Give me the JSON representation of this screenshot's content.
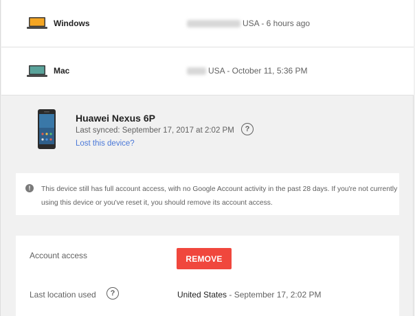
{
  "devices": [
    {
      "name": "Windows",
      "location_suffix": "USA - 6 hours ago",
      "icon": "laptop-icon-yellow"
    },
    {
      "name": "Mac",
      "location_suffix": "USA - October 11, 5:36 PM",
      "icon": "laptop-icon-teal"
    }
  ],
  "phone": {
    "title": "Huawei Nexus 6P",
    "last_synced": "Last synced: September 17, 2017 at 2:02 PM",
    "lost_link": "Lost this device?",
    "help_glyph": "?"
  },
  "notice": {
    "icon_glyph": "!",
    "text": "This device still has full account access, with no Google Account activity in the past 28 days. If you're not currently using this device or you've reset it, you should remove its account access."
  },
  "access": {
    "label": "Account access",
    "remove_label": "REMOVE",
    "location_label": "Last location used",
    "location_value": "United States",
    "location_time": " - September 17, 2:02 PM",
    "help_glyph": "?"
  },
  "colors": {
    "remove_button": "#f0473d",
    "link": "#4a78d8"
  }
}
